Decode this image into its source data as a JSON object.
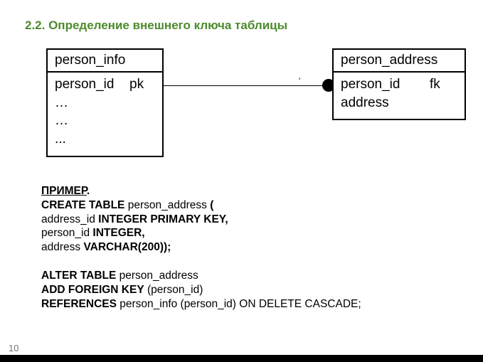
{
  "heading": "2.2. Определение внешнего ключа таблицы",
  "diagram": {
    "left_table": {
      "title": "person_info",
      "rows": [
        {
          "name": "person_id",
          "key": "pk"
        },
        {
          "name": "…",
          "key": ""
        },
        {
          "name": "…",
          "key": ""
        },
        {
          "name": "...",
          "key": ""
        }
      ]
    },
    "right_table": {
      "title": "person_address",
      "rows": [
        {
          "name": "person_id",
          "key": "fk"
        },
        {
          "name": "address",
          "key": ""
        }
      ]
    },
    "tick_mark": "'"
  },
  "code": {
    "l1_u": "ПРИМЕР",
    "l1_rest": ".",
    "l2_b1": "CREATE TABLE",
    "l2_mid": " person_address ",
    "l2_b2": "(",
    "l3_a": "address_id ",
    "l3_b": "INTEGER PRIMARY KEY,",
    "l4_a": "person_id ",
    "l4_b": "INTEGER,",
    "l5_a": "address ",
    "l5_b": "VARCHAR(200));",
    "l6": "",
    "l7_b": "ALTER TABLE",
    "l7_a": " person_address",
    "l8_b": "ADD FOREIGN KEY",
    "l8_a": " (person_id)",
    "l9_b": "REFERENCES",
    "l9_a": " person_info (person_id) ON DELETE CASCADE;"
  },
  "page_number": "10"
}
